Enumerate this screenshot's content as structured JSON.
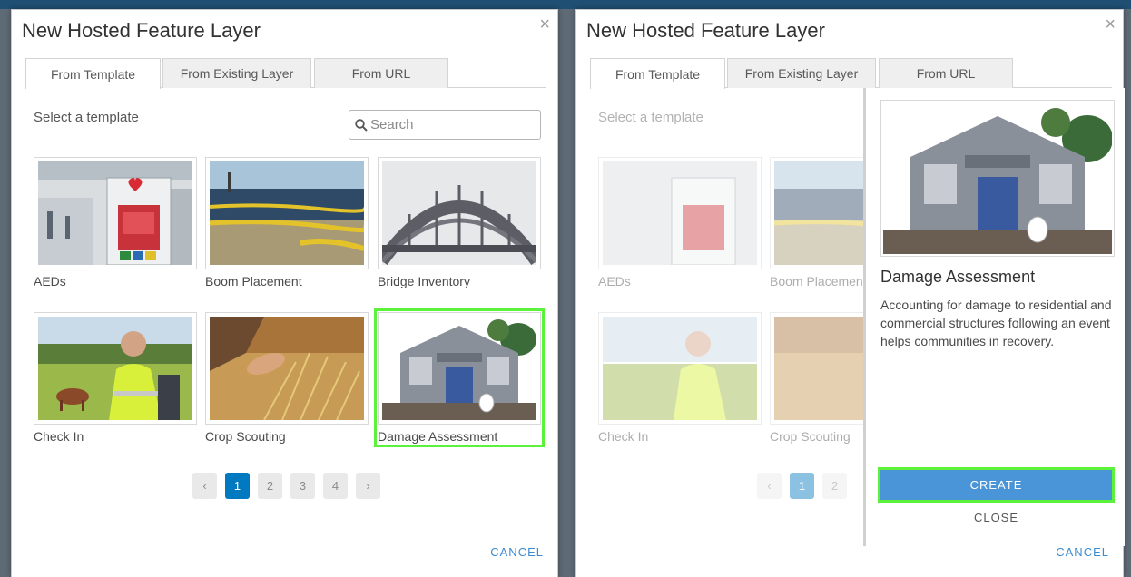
{
  "dialog": {
    "title": "New Hosted Feature Layer",
    "close_glyph": "×",
    "tabs": [
      {
        "label": "From Template"
      },
      {
        "label": "From Existing Layer"
      },
      {
        "label": "From URL"
      }
    ],
    "select_label": "Select a template",
    "search": {
      "placeholder": "Search",
      "value": ""
    },
    "templates": [
      {
        "label": "AEDs"
      },
      {
        "label": "Boom Placement"
      },
      {
        "label": "Bridge Inventory"
      },
      {
        "label": "Check In"
      },
      {
        "label": "Crop Scouting"
      },
      {
        "label": "Damage Assessment"
      }
    ],
    "pager": {
      "prev": "‹",
      "next": "›",
      "pages": [
        "1",
        "2",
        "3",
        "4"
      ],
      "current": "1"
    },
    "cancel_label": "CANCEL"
  },
  "detail": {
    "title": "Damage Assessment",
    "description": "Accounting for damage to residential and commercial structures following an event helps communities in recovery.",
    "create_label": "CREATE",
    "close_label": "CLOSE"
  },
  "colors": {
    "accent": "#0079c1",
    "create_button": "#4a95d8",
    "highlight": "#5cf23c",
    "link": "#3b8bd1"
  },
  "icons": {
    "search": "magnifier-icon",
    "close": "close-icon"
  }
}
